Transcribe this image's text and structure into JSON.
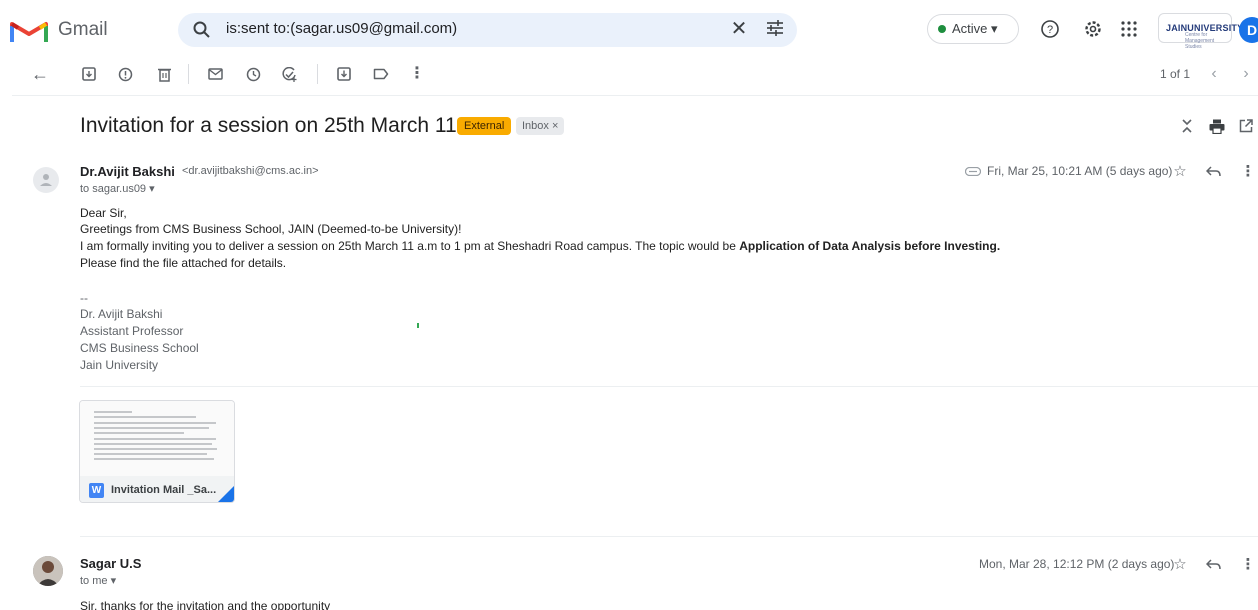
{
  "app": {
    "name": "Gmail"
  },
  "search": {
    "query": "is:sent to:(sagar.us09@gmail.com)"
  },
  "status": {
    "label": "Active ▾"
  },
  "org_badge": {
    "name": "JAINUNIVERSITY",
    "subtitle": "Centre for Management Studies"
  },
  "account": {
    "initial": "D"
  },
  "pager": {
    "text": "1 of 1"
  },
  "thread": {
    "subject": "Invitation for a session on 25th March 11 am",
    "labels": {
      "external": "External",
      "inbox": "Inbox ×"
    }
  },
  "message1": {
    "sender_name": "Dr.Avijit Bakshi",
    "sender_email": "<dr.avijitbakshi@cms.ac.in>",
    "to": "to sagar.us09 ▾",
    "date": "Fri, Mar 25, 10:21 AM (5 days ago)",
    "body": {
      "greeting": "Dear Sir,",
      "line1": "Greetings from CMS Business School, JAIN (Deemed-to-be University)!",
      "line2_prefix": "I am formally inviting you to deliver a session on 25th March 11 a.m to 1 pm at Sheshadri Road campus. The topic would be ",
      "line2_bold": "Application of Data Analysis before Investing.",
      "line3": "Please find the file attached for details."
    },
    "signature": {
      "sep": "--",
      "name": "Dr. Avijit Bakshi",
      "title": "Assistant Professor",
      "school": "CMS Business School",
      "university": "Jain University"
    },
    "attachment": {
      "name": "Invitation Mail _Sa...",
      "type_glyph": "W"
    }
  },
  "message2": {
    "sender_name": "Sagar U.S",
    "to": "to me ▾",
    "date": "Mon, Mar 28, 12:12 PM (2 days ago)",
    "body": "Sir, thanks for the invitation and the opportunity"
  },
  "colors": {
    "external_label": "#f9ab00",
    "active_dot": "#1e8e3e",
    "search_bg": "#eaf1fb",
    "account_avatar": "#1a73e8"
  },
  "icons": {
    "toolbar": [
      "back-arrow-icon",
      "archive-icon",
      "report-spam-icon",
      "delete-icon",
      "mark-unread-icon",
      "snooze-icon",
      "add-to-tasks-icon",
      "move-to-icon",
      "label-icon",
      "more-vert-icon"
    ],
    "header": [
      "search-icon",
      "clear-icon",
      "tune-icon",
      "help-icon",
      "settings-icon",
      "apps-icon"
    ]
  }
}
